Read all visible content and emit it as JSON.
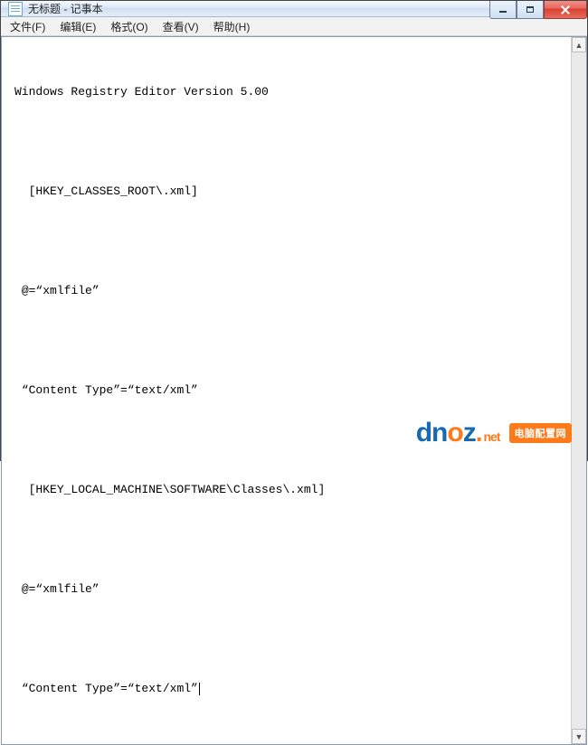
{
  "window": {
    "title": "无标题 - 记事本"
  },
  "menubar": {
    "items": [
      {
        "label": "文件(F)"
      },
      {
        "label": "编辑(E)"
      },
      {
        "label": "格式(O)"
      },
      {
        "label": "查看(V)"
      },
      {
        "label": "帮助(H)"
      }
    ]
  },
  "editor": {
    "lines": [
      "Windows Registry Editor Version 5.00",
      "",
      "  [HKEY_CLASSES_ROOT\\.xml]",
      "",
      " @=“xmlfile”",
      "",
      " “Content Type”=“text/xml”",
      "",
      "  [HKEY_LOCAL_MACHINE\\SOFTWARE\\Classes\\.xml]",
      "",
      " @=“xmlfile”",
      "",
      " “Content Type”=“text/xml”"
    ]
  },
  "watermark": {
    "badge": "电脑配置网",
    "logo_prefix": "dn",
    "logo_o": "o",
    "logo_suffix": "z",
    "logo_dot": ".",
    "logo_tld": "net"
  },
  "scrollbar": {
    "up": "▲",
    "down": "▼"
  }
}
